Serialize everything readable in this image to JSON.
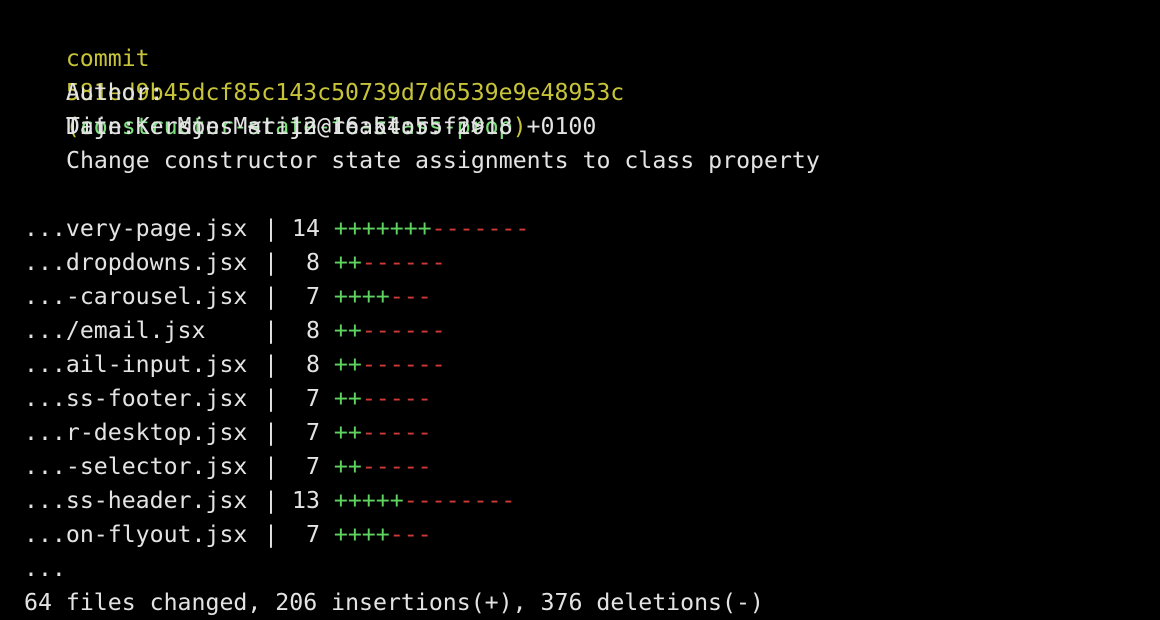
{
  "commit": {
    "keyword": "commit",
    "hash": "581ed9b45dcf85c143c50739d7d6539e9e48953c",
    "paren_open": "(",
    "branch": "constructor-state-to-class-prop",
    "paren_close": ")"
  },
  "author": {
    "label": "Author:",
    "value": "Tijn Kersjes <tijn@reaktor.fi>"
  },
  "date": {
    "label": "Date:",
    "value": "Mon Mar 12 16:54:55 2018 +0100"
  },
  "message": "Change constructor state assignments to class property",
  "stats": [
    {
      "file": "...very-page.jsx",
      "count": "14",
      "plus": "+++++++",
      "minus": "-------"
    },
    {
      "file": "...dropdowns.jsx",
      "count": "8",
      "plus": "++",
      "minus": "------"
    },
    {
      "file": "...-carousel.jsx",
      "count": "7",
      "plus": "++++",
      "minus": "---"
    },
    {
      "file": ".../email.jsx",
      "count": "8",
      "plus": "++",
      "minus": "------"
    },
    {
      "file": "...ail-input.jsx",
      "count": "8",
      "plus": "++",
      "minus": "------"
    },
    {
      "file": "...ss-footer.jsx",
      "count": "7",
      "plus": "++",
      "minus": "-----"
    },
    {
      "file": "...r-desktop.jsx",
      "count": "7",
      "plus": "++",
      "minus": "-----"
    },
    {
      "file": "...-selector.jsx",
      "count": "7",
      "plus": "++",
      "minus": "-----"
    },
    {
      "file": "...ss-header.jsx",
      "count": "13",
      "plus": "+++++",
      "minus": "--------"
    },
    {
      "file": "...on-flyout.jsx",
      "count": "7",
      "plus": "++++",
      "minus": "---"
    }
  ],
  "ellipsis": "...",
  "summary": "64 files changed, 206 insertions(+), 376 deletions(-)",
  "colors": {
    "background": "#000000",
    "text": "#e3e3e3",
    "commit_yellow": "#c7c43a",
    "branch_green": "#7fe07f",
    "insert_green": "#5fd35f",
    "delete_red": "#d23a3a"
  }
}
